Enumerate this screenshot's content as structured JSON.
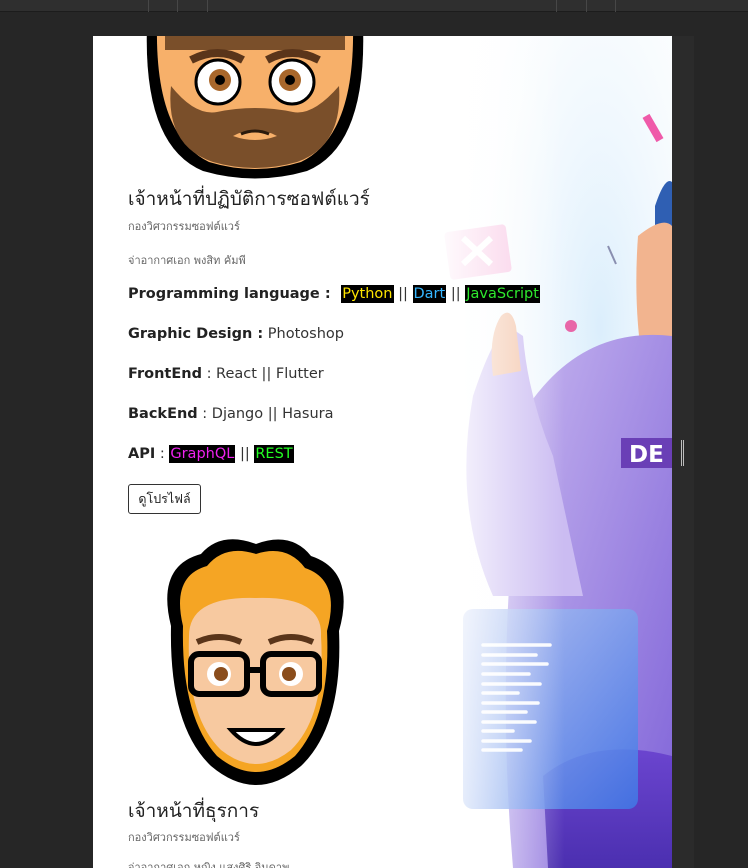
{
  "profile1": {
    "title": "เจ้าหน้าที่ปฏิบัติการซอฟต์แวร์",
    "department": "กองวิศวกรรมซอฟต์แวร์",
    "person": "จ่าอากาศเอก พงสิท คัมพี",
    "programming": {
      "label": "Programming language :",
      "items": [
        "Python",
        "Dart",
        "JavaScript"
      ],
      "sep": "||"
    },
    "graphic": {
      "label": "Graphic Design :",
      "value": "Photoshop"
    },
    "frontend": {
      "label": "FrontEnd",
      "value": ": React || Flutter"
    },
    "backend": {
      "label": "BackEnd",
      "value": ": Django || Hasura"
    },
    "api": {
      "label": "API",
      "colon": ":",
      "items": [
        "GraphQL",
        "REST"
      ],
      "sep": "||"
    },
    "profile_button": "ดูโปรไฟล์"
  },
  "profile2": {
    "title": "เจ้าหน้าที่ธุรการ",
    "department": "กองวิศวกรรมซอฟต์แวร์",
    "person": "จ่าอากาศเอก หญิง แสงศิริ จินดาพ"
  },
  "hero": {
    "badge_text": "DE"
  },
  "colors": {
    "python": "#ffe600",
    "dart": "#35b6ff",
    "javascript": "#2ee82e",
    "graphql": "#ee22ee",
    "rest": "#22ff22"
  }
}
